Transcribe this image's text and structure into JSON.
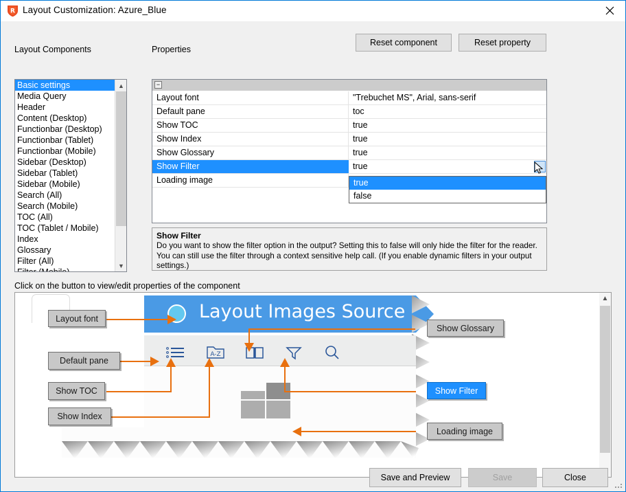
{
  "window": {
    "title": "Layout Customization: Azure_Blue",
    "app_icon": "robohelp-shield-icon",
    "close_label": "✕"
  },
  "toolbar": {
    "reset_component": "Reset component",
    "reset_property": "Reset property"
  },
  "components_panel": {
    "label": "Layout Components",
    "items": [
      {
        "label": "Basic settings",
        "selected": true
      },
      {
        "label": "Media Query",
        "selected": false
      },
      {
        "label": "Header",
        "selected": false
      },
      {
        "label": "Content (Desktop)",
        "selected": false
      },
      {
        "label": "Functionbar (Desktop)",
        "selected": false
      },
      {
        "label": "Functionbar (Tablet)",
        "selected": false
      },
      {
        "label": "Functionbar (Mobile)",
        "selected": false
      },
      {
        "label": "Sidebar (Desktop)",
        "selected": false
      },
      {
        "label": "Sidebar (Tablet)",
        "selected": false
      },
      {
        "label": "Sidebar (Mobile)",
        "selected": false
      },
      {
        "label": "Search (All)",
        "selected": false
      },
      {
        "label": "Search (Mobile)",
        "selected": false
      },
      {
        "label": "TOC (All)",
        "selected": false
      },
      {
        "label": "TOC (Tablet / Mobile)",
        "selected": false
      },
      {
        "label": "Index",
        "selected": false
      },
      {
        "label": "Glossary",
        "selected": false
      },
      {
        "label": "Filter (All)",
        "selected": false
      },
      {
        "label": "Filter (Mobile)",
        "selected": false
      }
    ]
  },
  "properties_panel": {
    "label": "Properties",
    "expander": "−",
    "rows": [
      {
        "name": "Layout font",
        "value": "\"Trebuchet MS\", Arial, sans-serif",
        "selected": false
      },
      {
        "name": "Default pane",
        "value": "toc",
        "selected": false
      },
      {
        "name": "Show TOC",
        "value": "true",
        "selected": false
      },
      {
        "name": "Show Index",
        "value": "true",
        "selected": false
      },
      {
        "name": "Show Glossary",
        "value": "true",
        "selected": false
      },
      {
        "name": "Show Filter",
        "value": "true",
        "selected": true
      },
      {
        "name": "Loading image",
        "value": "",
        "selected": false
      }
    ],
    "dropdown": {
      "open": true,
      "options": [
        {
          "label": "true",
          "selected": true
        },
        {
          "label": "false",
          "selected": false
        }
      ]
    }
  },
  "description": {
    "title": "Show Filter",
    "text": "Do you want to show the filter option in the output? Setting this to false will only hide the filter for the reader. You can still use the filter through a context sensitive help call. (If you enable dynamic filters in your output settings.)"
  },
  "preview": {
    "hint": "Click on the button to view/edit properties of the component",
    "banner_title": "Layout Images Source",
    "toolbar_icons": [
      {
        "name": "toc-list-icon",
        "label": "TOC"
      },
      {
        "name": "index-az-icon",
        "label": "A-Z"
      },
      {
        "name": "glossary-book-icon",
        "label": "Glossary"
      },
      {
        "name": "filter-funnel-icon",
        "label": "Filter"
      },
      {
        "name": "search-magnifier-icon",
        "label": "Search"
      }
    ],
    "callouts": [
      {
        "label": "Layout font",
        "highlighted": false
      },
      {
        "label": "Default pane",
        "highlighted": false
      },
      {
        "label": "Show TOC",
        "highlighted": false
      },
      {
        "label": "Show Index",
        "highlighted": false
      },
      {
        "label": "Show Glossary",
        "highlighted": false
      },
      {
        "label": "Show Filter",
        "highlighted": true
      },
      {
        "label": "Loading image",
        "highlighted": false
      }
    ]
  },
  "footer": {
    "save_and_preview": "Save and Preview",
    "save": "Save",
    "save_disabled": true,
    "close": "Close"
  },
  "colors": {
    "accent_blue": "#1e90ff",
    "banner_blue": "#4a9ae5",
    "callout_orange": "#e8700f",
    "window_border": "#0078d7",
    "icon_blue": "#2a5699"
  }
}
